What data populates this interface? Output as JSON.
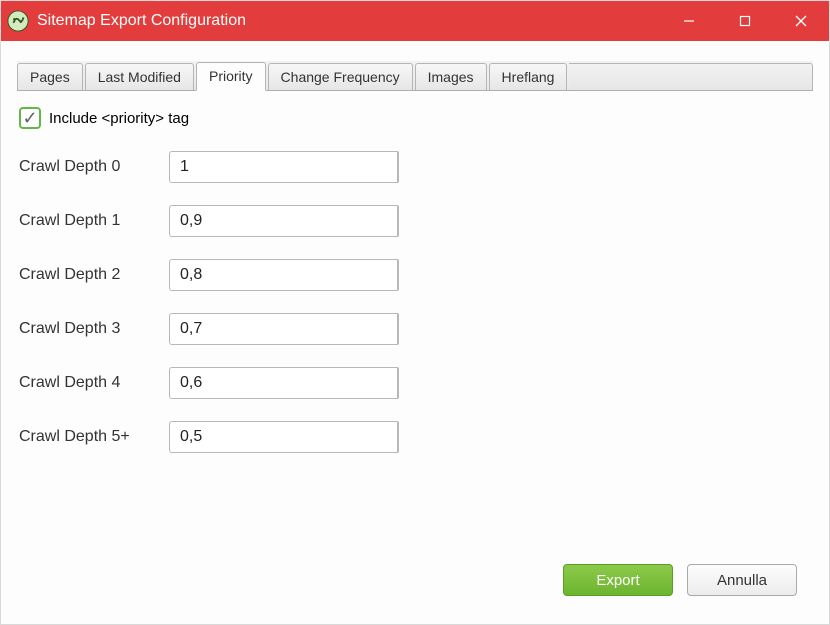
{
  "window": {
    "title": "Sitemap Export Configuration"
  },
  "tabs": [
    {
      "label": "Pages",
      "active": false
    },
    {
      "label": "Last Modified",
      "active": false
    },
    {
      "label": "Priority",
      "active": true
    },
    {
      "label": "Change Frequency",
      "active": false
    },
    {
      "label": "Images",
      "active": false
    },
    {
      "label": "Hreflang",
      "active": false
    }
  ],
  "priority_panel": {
    "include_checkbox": {
      "checked": true,
      "label": "Include <priority> tag"
    },
    "rows": [
      {
        "label": "Crawl Depth 0",
        "value": "1"
      },
      {
        "label": "Crawl Depth 1",
        "value": "0,9"
      },
      {
        "label": "Crawl Depth 2",
        "value": "0,8"
      },
      {
        "label": "Crawl Depth 3",
        "value": "0,7"
      },
      {
        "label": "Crawl Depth 4",
        "value": "0,6"
      },
      {
        "label": "Crawl Depth 5+",
        "value": "0,5"
      }
    ]
  },
  "footer": {
    "export_label": "Export",
    "cancel_label": "Annulla"
  }
}
